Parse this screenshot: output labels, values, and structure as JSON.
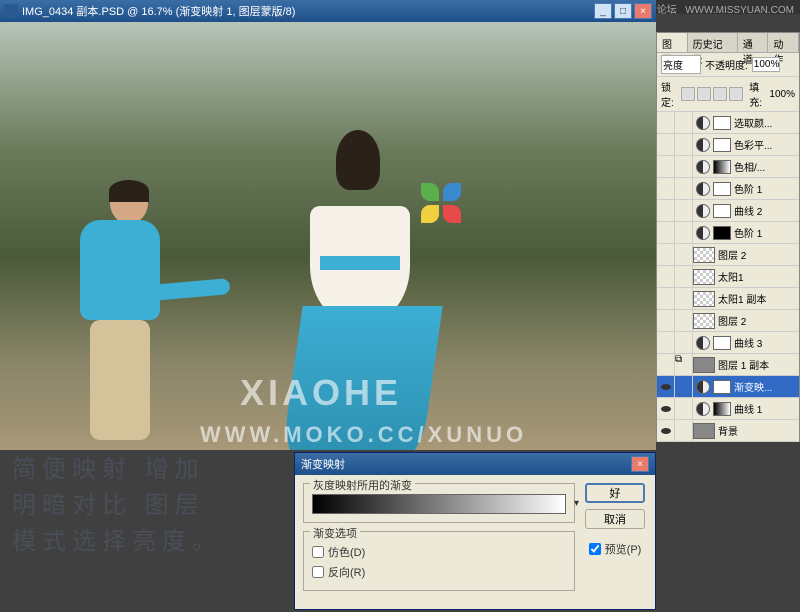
{
  "topbar": {
    "site": "思缘设计论坛",
    "url": "WWW.MISSYUAN.COM"
  },
  "window": {
    "title": "IMG_0434 副本.PSD @ 16.7% (渐变映射 1, 图层蒙版/8)",
    "watermark1": "XIAOHE",
    "watermark2": "WWW.MOKO.CC/XUNUO"
  },
  "caption": {
    "line1": "简便映射  增加",
    "line2": "明暗对比  图层",
    "line3": "模式选择亮度。"
  },
  "dialog": {
    "title": "渐变映射",
    "group1_label": "灰度映射所用的渐变",
    "group2_label": "渐变选项",
    "opt_dither": "仿色(D)",
    "opt_reverse": "反向(R)",
    "btn_ok": "好",
    "btn_cancel": "取消",
    "btn_preview": "预览(P)"
  },
  "panel": {
    "tabs": [
      "图层",
      "历史记录",
      "通道",
      "动作"
    ],
    "blend_label": "亮度",
    "opacity_label": "不透明度:",
    "opacity_val": "100%",
    "lock_label": "锁定:",
    "fill_label": "填充:",
    "fill_val": "100%",
    "layers": [
      {
        "name": "选取颜...",
        "type": "adjust",
        "mask": "white",
        "vis": false
      },
      {
        "name": "色彩平...",
        "type": "adjust",
        "mask": "white",
        "vis": false
      },
      {
        "name": "色相/...",
        "type": "adjust",
        "mask": "gradient",
        "vis": false
      },
      {
        "name": "色阶 1",
        "type": "adjust",
        "mask": "white",
        "vis": false
      },
      {
        "name": "曲线 2",
        "type": "adjust",
        "mask": "white",
        "vis": false
      },
      {
        "name": "色阶 1",
        "type": "adjust",
        "mask": "black",
        "vis": false
      },
      {
        "name": "图层 2",
        "type": "image",
        "thumb": "checker",
        "vis": false
      },
      {
        "name": "太阳1",
        "type": "image",
        "thumb": "checker",
        "vis": false
      },
      {
        "name": "太阳1 副本",
        "type": "image",
        "thumb": "checker",
        "vis": false
      },
      {
        "name": "图层 2",
        "type": "image",
        "thumb": "checker",
        "vis": false
      },
      {
        "name": "曲线 3",
        "type": "adjust",
        "mask": "white",
        "vis": false
      },
      {
        "name": "图层 1 副本",
        "type": "image",
        "thumb": "img",
        "vis": false,
        "linked": true
      },
      {
        "name": "渐变映...",
        "type": "adjust",
        "mask": "white",
        "vis": true,
        "selected": true
      },
      {
        "name": "曲线 1",
        "type": "adjust",
        "mask": "gradient",
        "vis": true
      },
      {
        "name": "背景",
        "type": "image",
        "thumb": "img",
        "vis": true
      }
    ]
  },
  "colors": {
    "pinwheel": [
      "#e84a4a",
      "#f0d040",
      "#5ab04a",
      "#3a8ad0"
    ]
  }
}
